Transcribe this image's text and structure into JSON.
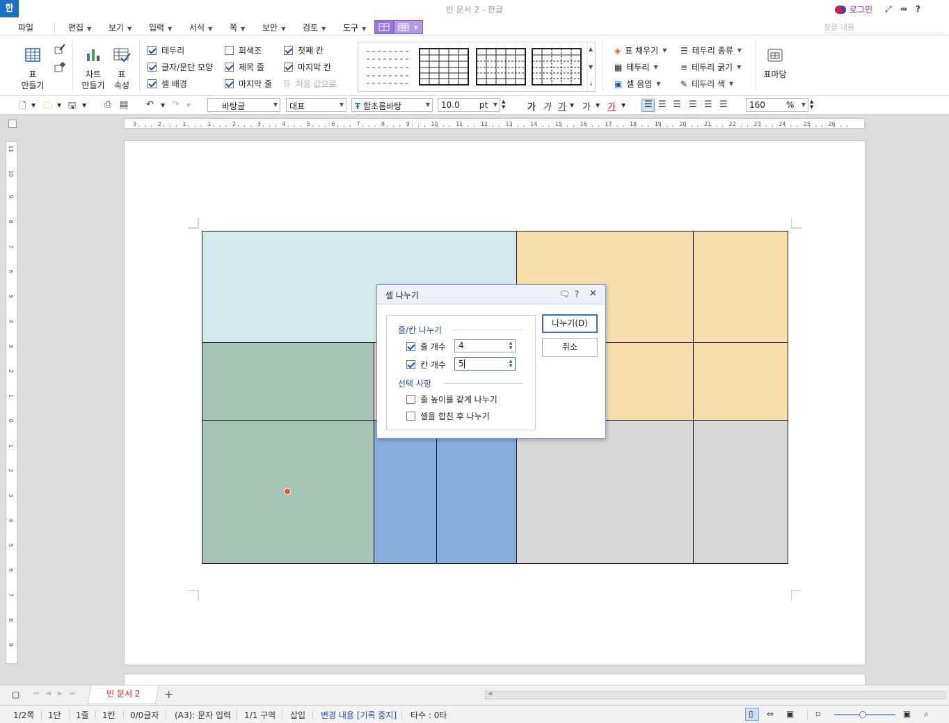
{
  "window": {
    "title": "빈 문서 2 - 한글",
    "app_logo": "한",
    "login": "로그인",
    "icons": [
      "fullscreen-icon",
      "restore-icon",
      "help-icon"
    ]
  },
  "menu": {
    "file": "파일",
    "items": [
      "편집",
      "보기",
      "입력",
      "서식",
      "쪽",
      "보안",
      "검토",
      "도구"
    ],
    "search_placeholder": "찾을 내용"
  },
  "ribbon": {
    "table_make": [
      "표",
      "만들기"
    ],
    "chart_make": [
      "차트",
      "만들기"
    ],
    "table_prop": [
      "표",
      "속성"
    ],
    "checks_col1": [
      {
        "label": "테두리",
        "checked": true
      },
      {
        "label": "글자/문단 모양",
        "checked": true
      },
      {
        "label": "셀 배경",
        "checked": true
      }
    ],
    "checks_col2": [
      {
        "label": "회색조",
        "checked": false
      },
      {
        "label": "제목 줄",
        "checked": true
      },
      {
        "label": "마지막 줄",
        "checked": true
      }
    ],
    "checks_col3": [
      {
        "label": "첫째 칸",
        "checked": true
      },
      {
        "label": "마지막 칸",
        "checked": true
      }
    ],
    "reset_label": "처음 값으로",
    "right_col1": [
      "표 채우기",
      "테두리",
      "셀 음영"
    ],
    "right_col2": [
      "테두리 종류",
      "테두리 굵기",
      "테두리 색"
    ],
    "table_madang": "표마당"
  },
  "format_bar": {
    "style": "바탕글",
    "lang": "대표",
    "font": "함초롬바탕",
    "size": "10.0",
    "unit": "pt",
    "char_buttons": [
      "가",
      "가",
      "가",
      "가",
      "가"
    ],
    "zoom": "160",
    "zoom_unit": "%"
  },
  "ruler": {
    "h_ticks": [
      "3",
      "2",
      "1",
      "1",
      "2",
      "3",
      "4",
      "5",
      "6",
      "7",
      "8",
      "9",
      "10",
      "11",
      "12",
      "13",
      "14",
      "15",
      "16",
      "17",
      "18",
      "19",
      "20",
      "21",
      "22",
      "23",
      "24",
      "25",
      "26"
    ],
    "v_ticks": [
      "11",
      "10",
      "9",
      "8",
      "7",
      "6",
      "5",
      "4",
      "3",
      "2",
      "1",
      "0",
      "1",
      "2",
      "3",
      "4",
      "5",
      "6",
      "7",
      "8",
      "9"
    ]
  },
  "table": {
    "colors": {
      "light_blue": "#d3e9ee",
      "orange": "#f6dfab",
      "green": "#a6c3b5",
      "blue": "#86aedb",
      "gray": "#d8d8d8",
      "pink": "#f5d0de"
    }
  },
  "dialog": {
    "title": "셀 나누기",
    "group1": "줄/칸 나누기",
    "rows_label": "줄 개수",
    "rows_value": "4",
    "rows_checked": true,
    "cols_label": "칸 개수",
    "cols_value": "5",
    "cols_checked": true,
    "group2": "선택 사항",
    "opt1": "줄 높이를 같게 나누기",
    "opt2": "셀을 합친 후 나누기",
    "split_button": "나누기(D)",
    "cancel_button": "취소"
  },
  "tabs": {
    "doc_tab": "빈 문서 2",
    "add": "+"
  },
  "status": {
    "page": "1/2쪽",
    "dan": "1단",
    "line": "1줄",
    "col": "1칸",
    "chars": "0/0글자",
    "mode": "(A3): 문자 입력",
    "section": "1/1 구역",
    "insert": "삽입",
    "track": "변경 내용 [기록 중지]",
    "typing": "타수 : 0타"
  }
}
